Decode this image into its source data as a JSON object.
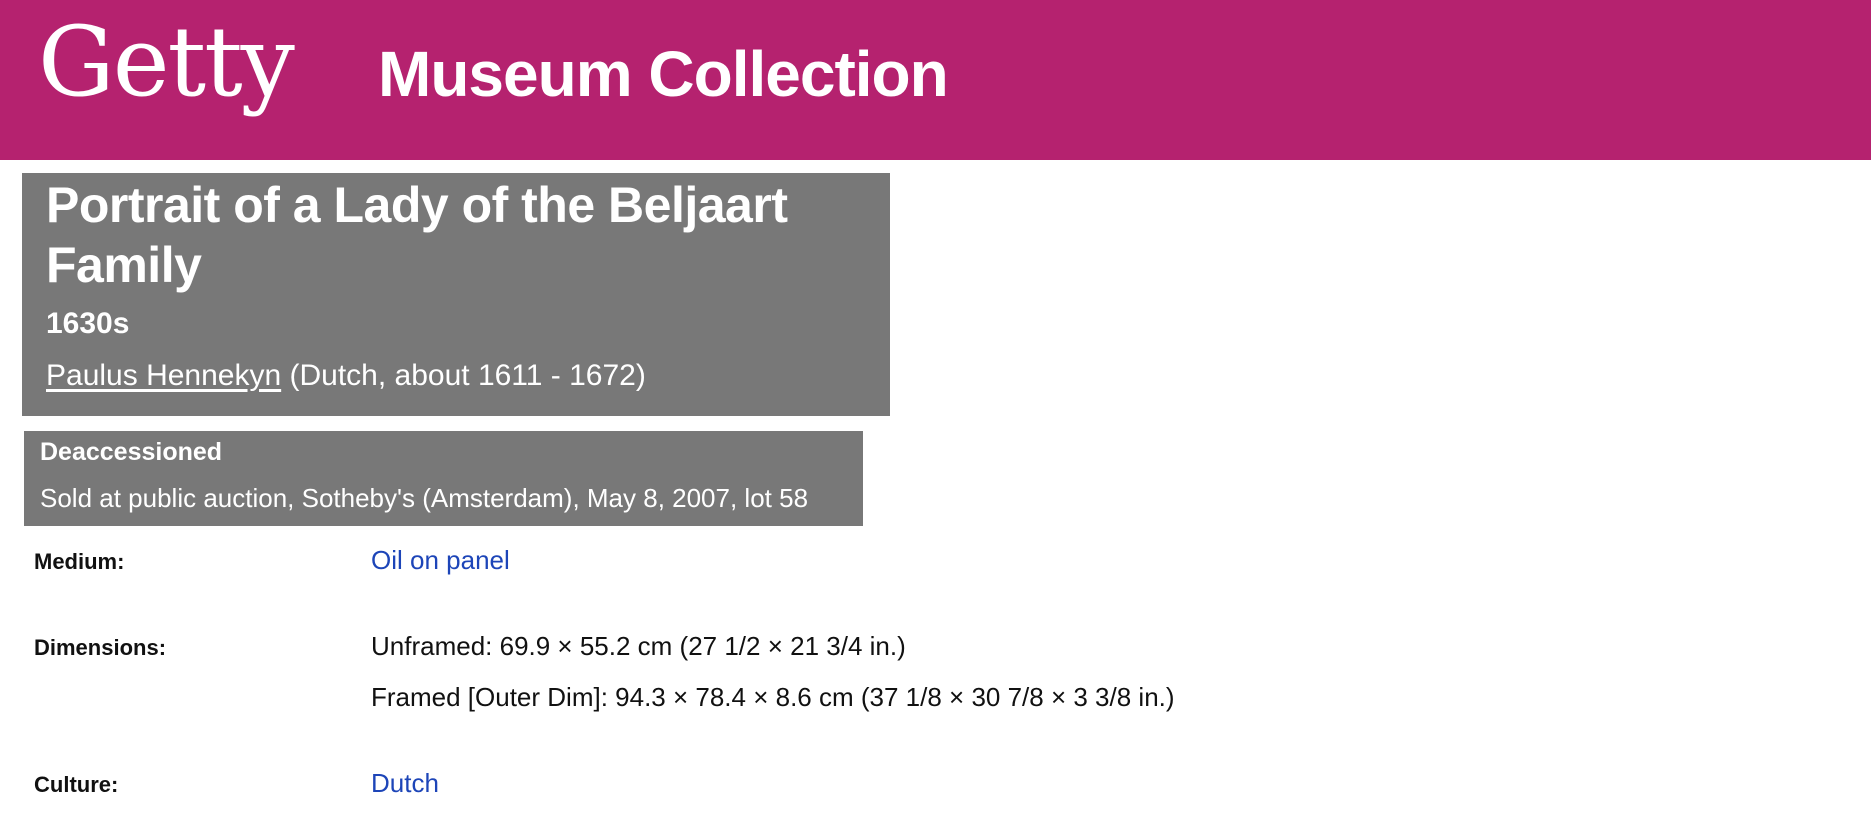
{
  "header": {
    "logo_text": "Getty",
    "site_title": "Museum Collection",
    "background_color": "#b5226f"
  },
  "object": {
    "title": "Portrait of a Lady of the Beljaart Family",
    "date": "1630s",
    "artist_name": "Paulus Hennekyn",
    "artist_details": "(Dutch, about 1611 - 1672)"
  },
  "deaccession": {
    "status": "Deaccessioned",
    "note": "Sold at public auction, Sotheby's (Amsterdam), May 8, 2007, lot 58"
  },
  "fields": {
    "medium": {
      "label": "Medium:",
      "value": "Oil on panel"
    },
    "dimensions": {
      "label": "Dimensions:",
      "unframed": "Unframed: 69.9 × 55.2 cm (27 1/2 × 21 3/4 in.)",
      "framed": "Framed [Outer Dim]: 94.3 × 78.4 × 8.6 cm (37 1/8 × 30 7/8 × 3 3/8 in.)"
    },
    "culture": {
      "label": "Culture:",
      "value": "Dutch"
    }
  },
  "colors": {
    "link": "#1d45b8",
    "panel": "#787878"
  }
}
